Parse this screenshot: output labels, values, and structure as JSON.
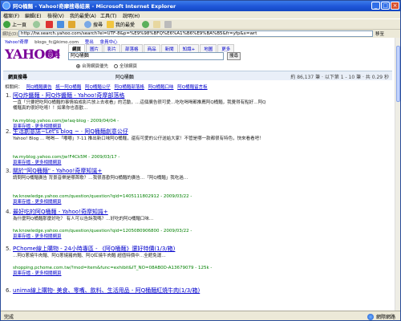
{
  "window": {
    "title": "阿Q桶麵 - Yahoo!奇摩搜尋結果 - Microsoft Internet Explorer",
    "minimize": "_",
    "maximize": "□",
    "close": "×"
  },
  "menu": [
    "檔案(F)",
    "編輯(E)",
    "檢視(V)",
    "我的最愛(A)",
    "工具(T)",
    "說明(H)"
  ],
  "toolbar": {
    "back": "上一頁",
    "search": "搜尋",
    "favorites": "我的最愛"
  },
  "address": {
    "label": "網址(D)",
    "url": "http://tw.search.yahoo.com/search?ei=UTF-8&p=%E9%98%BFQ%E6%A1%B6%E9%BA%B5&fr=yfp&x=wrt",
    "go": "移至"
  },
  "page": {
    "top_links": [
      "Yahoo!奇摩",
      "blogs_fc@kimo.com",
      "登出",
      "會員中心"
    ],
    "logo": "YAHOO!",
    "logo_sub": "搜尋",
    "tabs": [
      "網頁",
      "圖片",
      "影片",
      "部落格",
      "商品",
      "新聞",
      "知識+",
      "地圖",
      "更多"
    ],
    "active_tab": "網頁",
    "query": "阿Q桶麵",
    "search_button": "搜尋",
    "radio_1": "台灣網頁優先",
    "radio_2": "全球網頁",
    "results_bar": {
      "left": "網頁搜尋",
      "mid": "阿Q桶麵",
      "right": "約 86,137 筆 · 以下第 1 - 10 筆 · 共 0.29 秒"
    },
    "related_label": "相關詞：",
    "related": [
      "阿Q桶麵廣告",
      "統一阿Q桶麵",
      "阿Q桶麵公仔",
      "阿Q桶麵部落格",
      "阿Q桶麵口味",
      "阿Q桶麵留言板"
    ]
  },
  "results": [
    {
      "num": "1.",
      "title": "阿Q炸醬麵 - 阿Q炸醬麵 - Yahoo!奇摩部落格",
      "snippet": "一直「只要把吃阿Q桶麵的事情拍成影片放上去收看」的活動，…這個廣告很可愛…吃吃喝喝都推薦阿Q桶麵，我覺得有點好…阿Q桶麵真的很好吃唷！！如果你也喜歡…",
      "url": "tw.myblog.yahoo.com/jw!aq-blog - 2009/04/04 -",
      "more": "頁庫存檔 - 更多相關網頁"
    },
    {
      "num": "2.",
      "title": "生活創意誌~Let's blog ~ · 阿Q桶麵創意公仔",
      "snippet": "Yahoo! Blog ... 喝喝—「嘟嘟」7-11 推出新口味阿Q桶麵，還有可愛的公仔送給大家！不管是哪一款都很有特色，快來看看吧！",
      "url": "tw.myblog.yahoo.com/jw!F4Ck5M - 2009/03/17 -",
      "more": "頁庫存檔 - 更多相關網頁"
    },
    {
      "num": "3.",
      "title": "關於\"阿Q桶麵\" - Yahoo!奇摩知識+",
      "snippet": "請問阿Q桶麵廣告 背景音樂是哪首歌？…我很喜歡阿Q桶麵的廣告…「阿Q桶麵」我吃過…",
      "url": "tw.knowledge.yahoo.com/question/question?qid=1405111802912 - 2009/03/22 -",
      "more": "頁庫存檔 - 更多相關網頁"
    },
    {
      "num": "4.",
      "title": "最好吃的阿Q桶麵 - Yahoo!奇摩知識+",
      "snippet": "為什麼阿Q桶麵那麼好吃？ 有人可以告訴我嗎？…好吃的阿Q桶麵口味…",
      "url": "tw.knowledge.yahoo.com/question/question?qid=1205080906800 - 2009/03/22 -",
      "more": "頁庫存檔 - 更多相關網頁"
    },
    {
      "num": "5.",
      "title": "PChome線上購物 - 24小時專區 - 《阿Q桶麵》還好特價(1/3/箱)",
      "snippet": "…阿Q蔥燒牛肉麵、阿Q蔥燒豬肉麵、阿Q紅燒牛肉麵 超值特價中…全館免運…",
      "url": "shopping.pchome.com.tw/?mod=item&func=exhibit&IT_NO=08AB0D-A13679079 - 125k -",
      "more": "頁庫存檔 - 更多相關網頁"
    },
    {
      "num": "6.",
      "title": "unima線上購物- 美食、零嘴、飲料、生活用品 - 阿Q桶麵紅燒牛肉(1/3/箱)",
      "snippet": "",
      "url": "",
      "more": ""
    }
  ],
  "status": {
    "left": "完成",
    "zone": "網際網路"
  }
}
